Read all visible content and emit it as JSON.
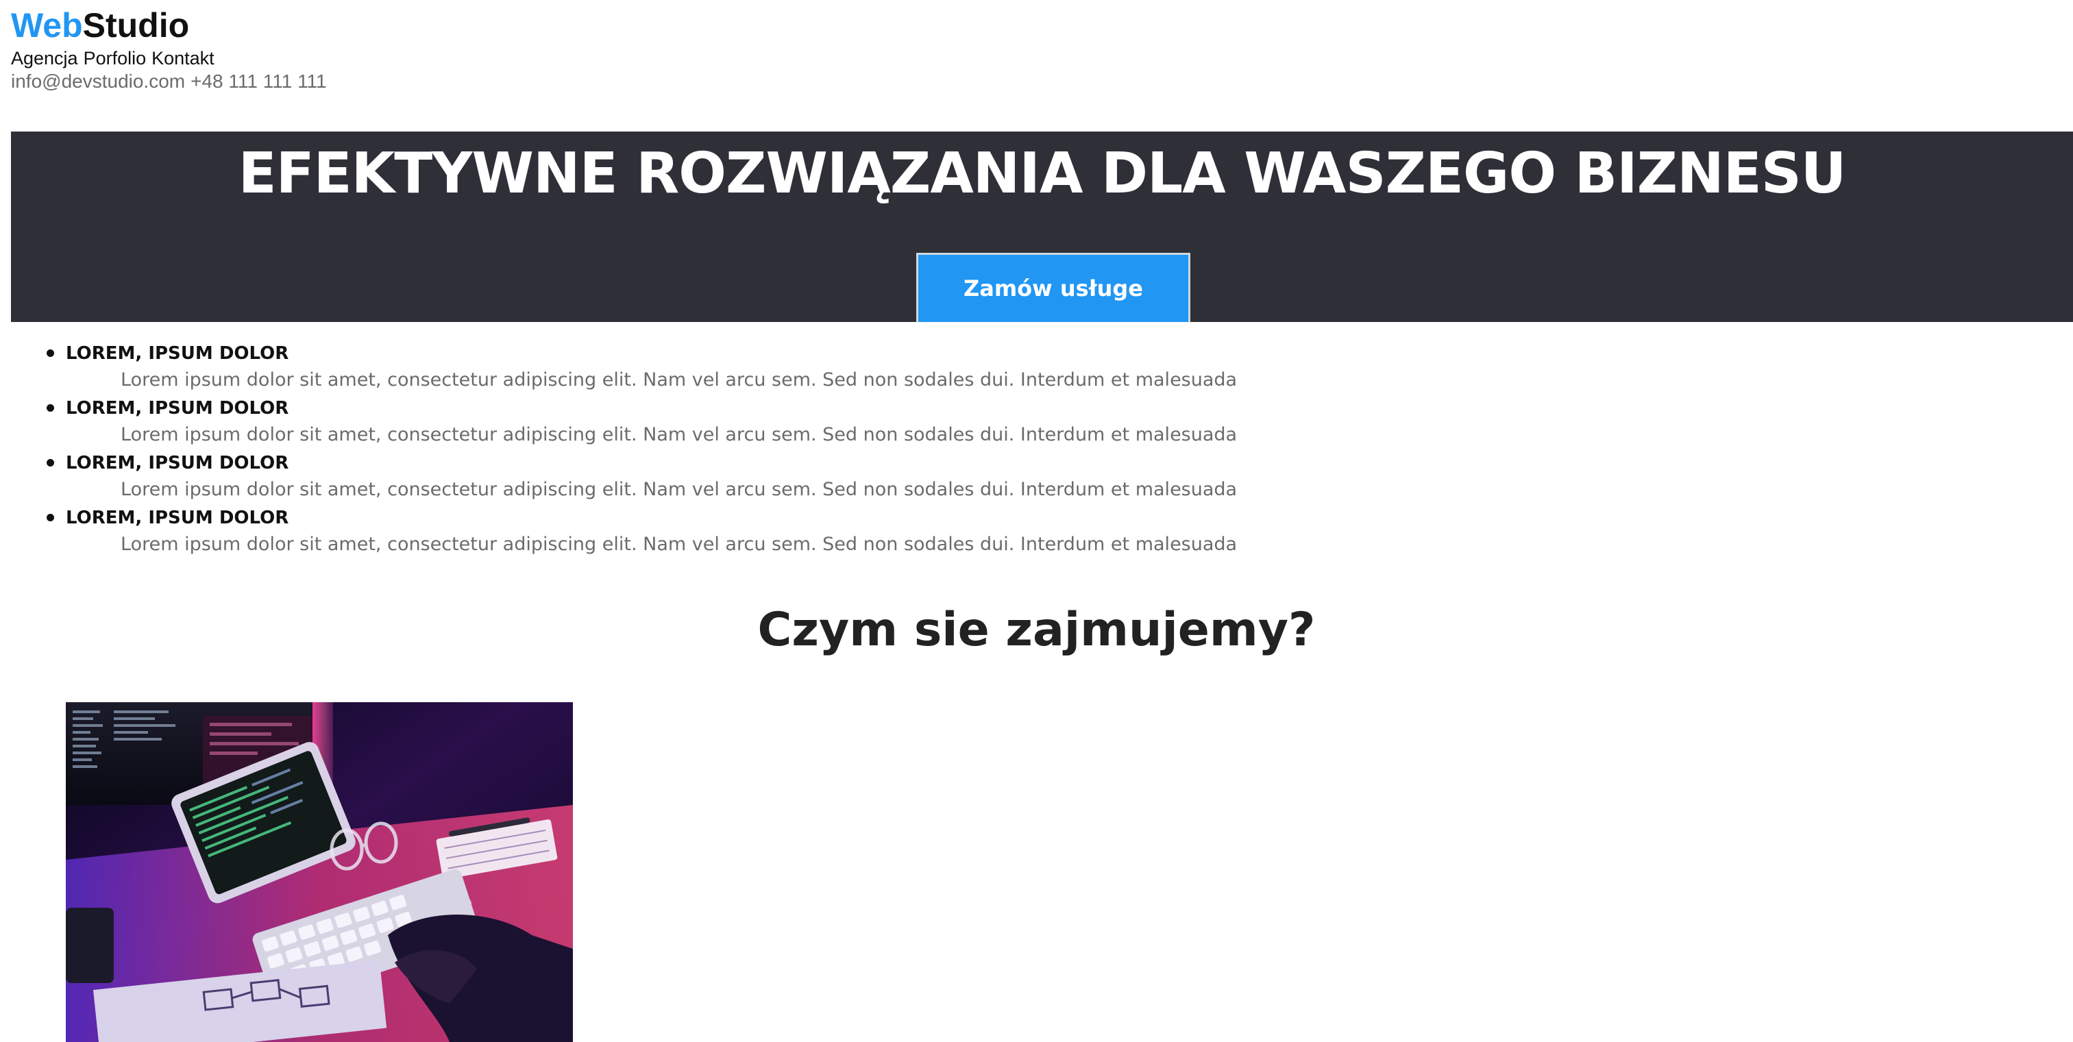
{
  "logo": {
    "part1": "Web",
    "part2": "Studio"
  },
  "nav": {
    "items": [
      "Agencja",
      "Porfolio",
      "Kontakt"
    ]
  },
  "contact": {
    "email": "info@devstudio.com",
    "phone": "+48 111 111 111"
  },
  "hero": {
    "title": "EFEKTYWNE ROZWIĄZANIA DLA WASZEGO BIZNESU",
    "button_label": "Zamów usługe"
  },
  "features": [
    {
      "title": "LOREM, IPSUM DOLOR",
      "description": "Lorem ipsum dolor sit amet, consectetur adipiscing elit. Nam vel arcu sem. Sed non sodales dui. Interdum et malesuada"
    },
    {
      "title": "LOREM, IPSUM DOLOR",
      "description": "Lorem ipsum dolor sit amet, consectetur adipiscing elit. Nam vel arcu sem. Sed non sodales dui. Interdum et malesuada"
    },
    {
      "title": "LOREM, IPSUM DOLOR",
      "description": "Lorem ipsum dolor sit amet, consectetur adipiscing elit. Nam vel arcu sem. Sed non sodales dui. Interdum et malesuada"
    },
    {
      "title": "LOREM, IPSUM DOLOR",
      "description": "Lorem ipsum dolor sit amet, consectetur adipiscing elit. Nam vel arcu sem. Sed non sodales dui. Interdum et malesuada"
    }
  ],
  "section": {
    "title": "Czym sie zajmujemy?"
  },
  "colors": {
    "accent": "#2196f3",
    "hero_background": "#2f2f38",
    "muted_text": "#6b6b6b"
  }
}
